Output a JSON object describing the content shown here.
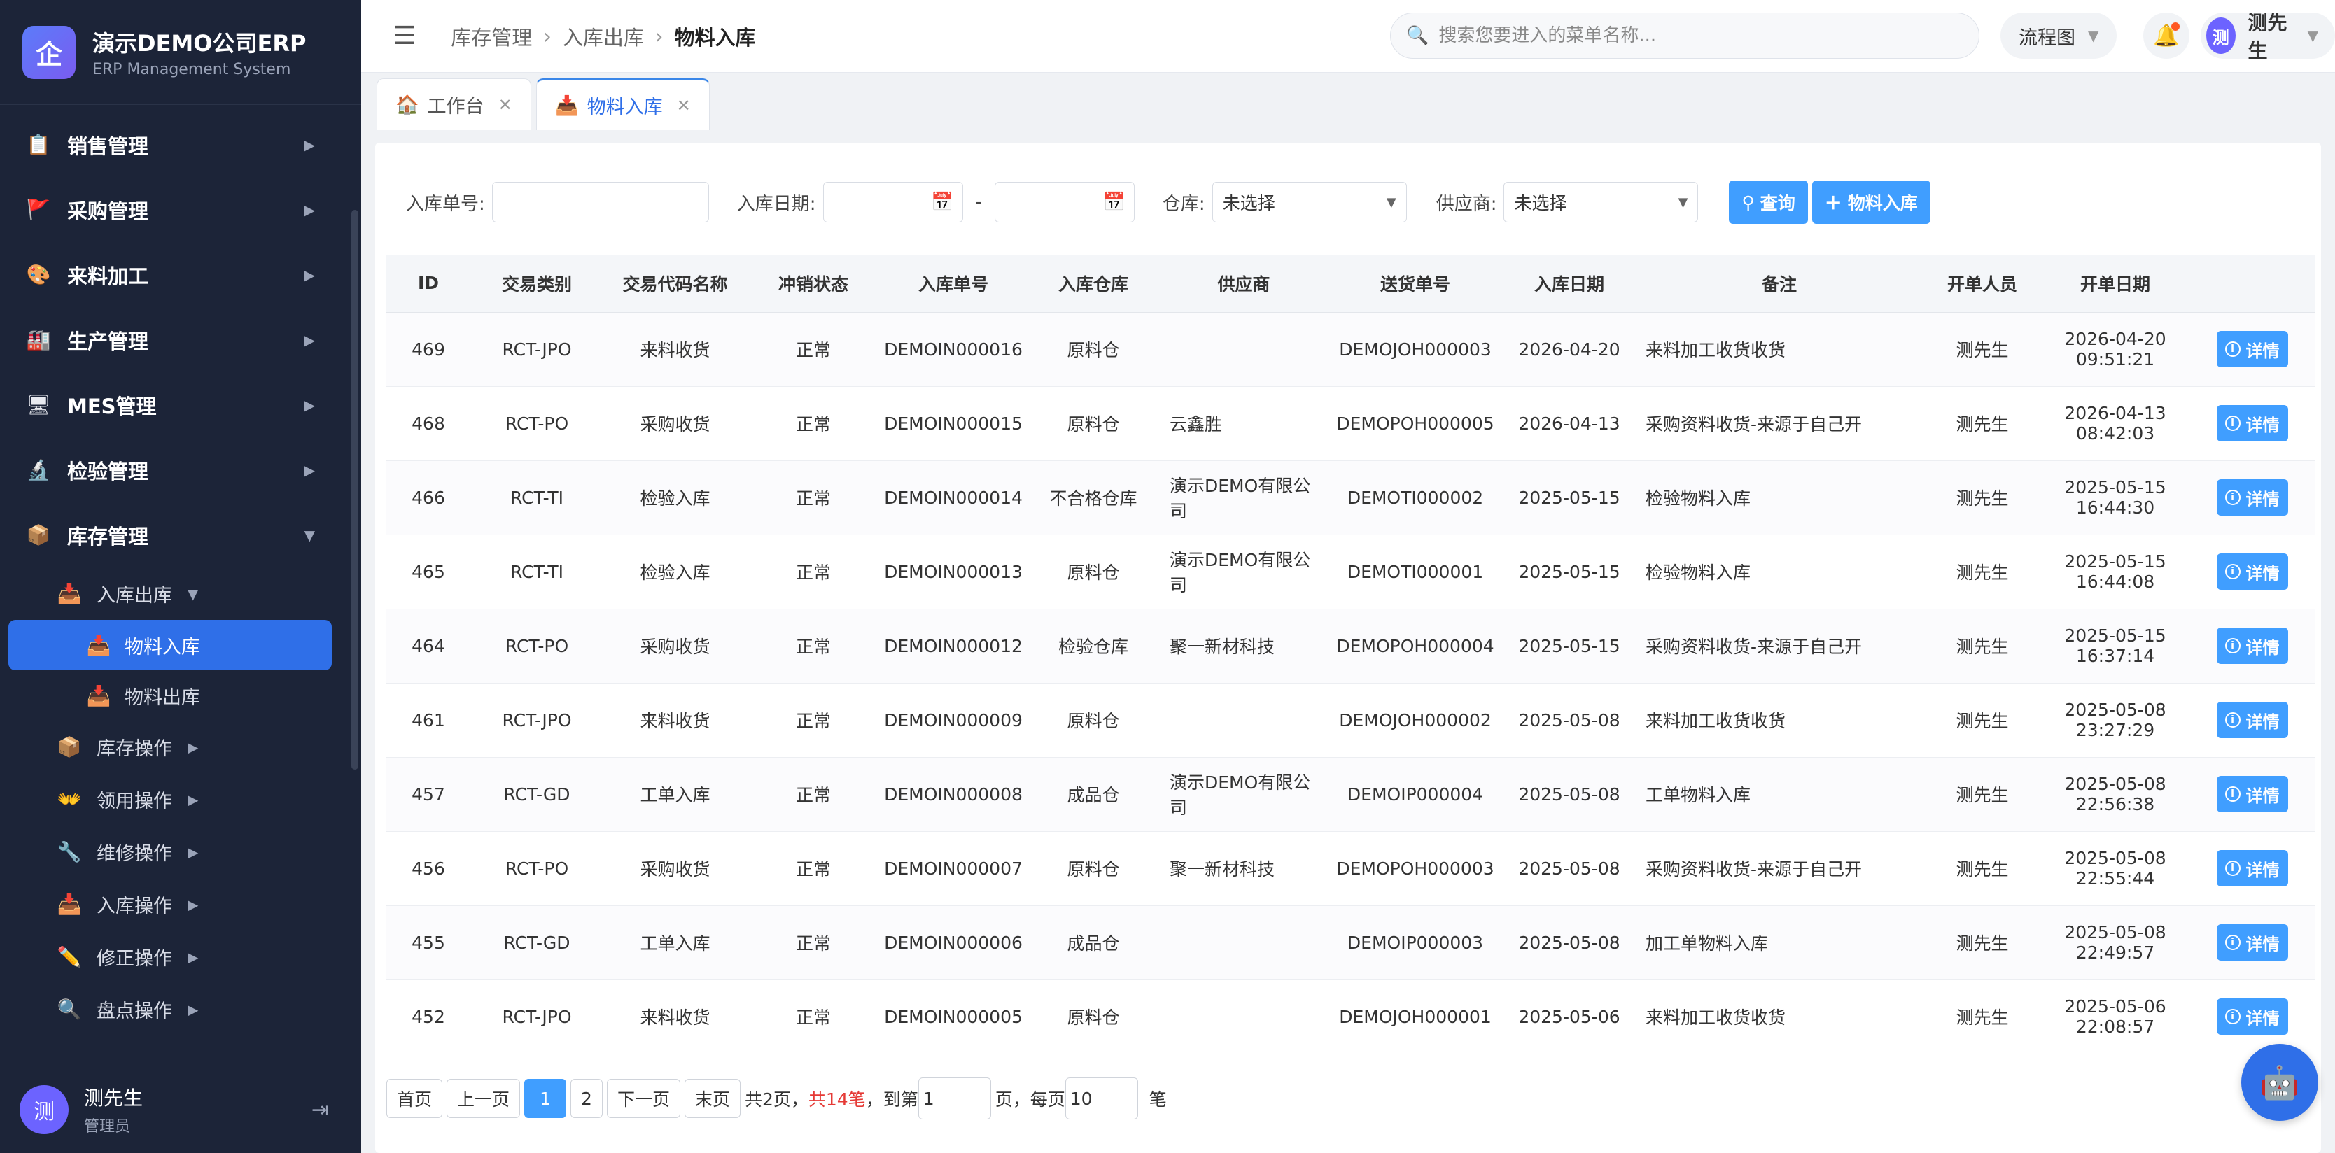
{
  "brand": {
    "title": "演示DEMO公司ERP",
    "subtitle": "ERP Management System",
    "logo_char": "企"
  },
  "sidebar": {
    "items": [
      {
        "label": "销售管理",
        "icon": "clipboard-icon"
      },
      {
        "label": "采购管理",
        "icon": "flag-icon"
      },
      {
        "label": "来料加工",
        "icon": "palette-icon"
      },
      {
        "label": "生产管理",
        "icon": "factory-icon"
      },
      {
        "label": "MES管理",
        "icon": "monitor-icon"
      },
      {
        "label": "检验管理",
        "icon": "microscope-icon"
      },
      {
        "label": "库存管理",
        "icon": "box-icon"
      }
    ],
    "inventory_sub": {
      "label": "入库出库"
    },
    "leaf": [
      {
        "label": "物料入库"
      },
      {
        "label": "物料出库"
      }
    ],
    "sub_items": [
      {
        "label": "库存操作"
      },
      {
        "label": "领用操作"
      },
      {
        "label": "维修操作"
      },
      {
        "label": "入库操作"
      },
      {
        "label": "修正操作"
      },
      {
        "label": "盘点操作"
      }
    ],
    "user": {
      "name": "测先生",
      "role": "管理员",
      "avatar": "测"
    }
  },
  "header": {
    "breadcrumb": [
      "库存管理",
      "入库出库",
      "物料入库"
    ],
    "search_placeholder": "搜索您要进入的菜单名称...",
    "flow_label": "流程图",
    "user_name": "测先生",
    "avatar": "测"
  },
  "tabs": [
    {
      "label": "工作台"
    },
    {
      "label": "物料入库"
    }
  ],
  "filters": {
    "order_no_label": "入库单号:",
    "date_label": "入库日期:",
    "date_sep": "-",
    "warehouse_label": "仓库:",
    "warehouse_value": "未选择",
    "supplier_label": "供应商:",
    "supplier_value": "未选择",
    "query_btn": "查询",
    "add_btn": "物料入库"
  },
  "table": {
    "headers": [
      "ID",
      "交易类别",
      "交易代码名称",
      "冲销状态",
      "入库单号",
      "入库仓库",
      "供应商",
      "送货单号",
      "入库日期",
      "备注",
      "开单人员",
      "开单日期",
      ""
    ],
    "detail_label": "详情",
    "rows": [
      {
        "id": "469",
        "type": "RCT-JPO",
        "code_name": "来料收货",
        "status": "正常",
        "order_no": "DEMOIN000016",
        "warehouse": "原料仓",
        "supplier": "",
        "delivery_no": "DEMOJOH000003",
        "date": "2026-04-20",
        "remark": "来料加工收货收货",
        "operator": "测先生",
        "created_date": "2026-04-20",
        "created_time": "09:51:21"
      },
      {
        "id": "468",
        "type": "RCT-PO",
        "code_name": "采购收货",
        "status": "正常",
        "order_no": "DEMOIN000015",
        "warehouse": "原料仓",
        "supplier": "云鑫胜",
        "delivery_no": "DEMOPOH000005",
        "date": "2026-04-13",
        "remark": "采购资料收货-来源于自己开",
        "operator": "测先生",
        "created_date": "2026-04-13",
        "created_time": "08:42:03"
      },
      {
        "id": "466",
        "type": "RCT-TI",
        "code_name": "检验入库",
        "status": "正常",
        "order_no": "DEMOIN000014",
        "warehouse": "不合格仓库",
        "supplier": "演示DEMO有限公司",
        "delivery_no": "DEMOTI000002",
        "date": "2025-05-15",
        "remark": "检验物料入库",
        "operator": "测先生",
        "created_date": "2025-05-15",
        "created_time": "16:44:30"
      },
      {
        "id": "465",
        "type": "RCT-TI",
        "code_name": "检验入库",
        "status": "正常",
        "order_no": "DEMOIN000013",
        "warehouse": "原料仓",
        "supplier": "演示DEMO有限公司",
        "delivery_no": "DEMOTI000001",
        "date": "2025-05-15",
        "remark": "检验物料入库",
        "operator": "测先生",
        "created_date": "2025-05-15",
        "created_time": "16:44:08"
      },
      {
        "id": "464",
        "type": "RCT-PO",
        "code_name": "采购收货",
        "status": "正常",
        "order_no": "DEMOIN000012",
        "warehouse": "检验仓库",
        "supplier": "聚一新材科技",
        "delivery_no": "DEMOPOH000004",
        "date": "2025-05-15",
        "remark": "采购资料收货-来源于自己开",
        "operator": "测先生",
        "created_date": "2025-05-15",
        "created_time": "16:37:14"
      },
      {
        "id": "461",
        "type": "RCT-JPO",
        "code_name": "来料收货",
        "status": "正常",
        "order_no": "DEMOIN000009",
        "warehouse": "原料仓",
        "supplier": "",
        "delivery_no": "DEMOJOH000002",
        "date": "2025-05-08",
        "remark": "来料加工收货收货",
        "operator": "测先生",
        "created_date": "2025-05-08",
        "created_time": "23:27:29"
      },
      {
        "id": "457",
        "type": "RCT-GD",
        "code_name": "工单入库",
        "status": "正常",
        "order_no": "DEMOIN000008",
        "warehouse": "成品仓",
        "supplier": "演示DEMO有限公司",
        "delivery_no": "DEMOIP000004",
        "date": "2025-05-08",
        "remark": "工单物料入库",
        "operator": "测先生",
        "created_date": "2025-05-08",
        "created_time": "22:56:38"
      },
      {
        "id": "456",
        "type": "RCT-PO",
        "code_name": "采购收货",
        "status": "正常",
        "order_no": "DEMOIN000007",
        "warehouse": "原料仓",
        "supplier": "聚一新材科技",
        "delivery_no": "DEMOPOH000003",
        "date": "2025-05-08",
        "remark": "采购资料收货-来源于自己开",
        "operator": "测先生",
        "created_date": "2025-05-08",
        "created_time": "22:55:44"
      },
      {
        "id": "455",
        "type": "RCT-GD",
        "code_name": "工单入库",
        "status": "正常",
        "order_no": "DEMOIN000006",
        "warehouse": "成品仓",
        "supplier": "",
        "delivery_no": "DEMOIP000003",
        "date": "2025-05-08",
        "remark": "加工单物料入库",
        "operator": "测先生",
        "created_date": "2025-05-08",
        "created_time": "22:49:57"
      },
      {
        "id": "452",
        "type": "RCT-JPO",
        "code_name": "来料收货",
        "status": "正常",
        "order_no": "DEMOIN000005",
        "warehouse": "原料仓",
        "supplier": "",
        "delivery_no": "DEMOJOH000001",
        "date": "2025-05-06",
        "remark": "来料加工收货收货",
        "operator": "测先生",
        "created_date": "2025-05-06",
        "created_time": "22:08:57"
      }
    ]
  },
  "pager": {
    "first": "首页",
    "prev": "上一页",
    "page1": "1",
    "page2": "2",
    "next": "下一页",
    "last": "末页",
    "total_pages": "共2页，",
    "total_count": "共14笔",
    "goto_label": "，到第",
    "goto_value": "1",
    "page_unit": "页，每页",
    "page_size": "10",
    "size_unit": "笔"
  }
}
